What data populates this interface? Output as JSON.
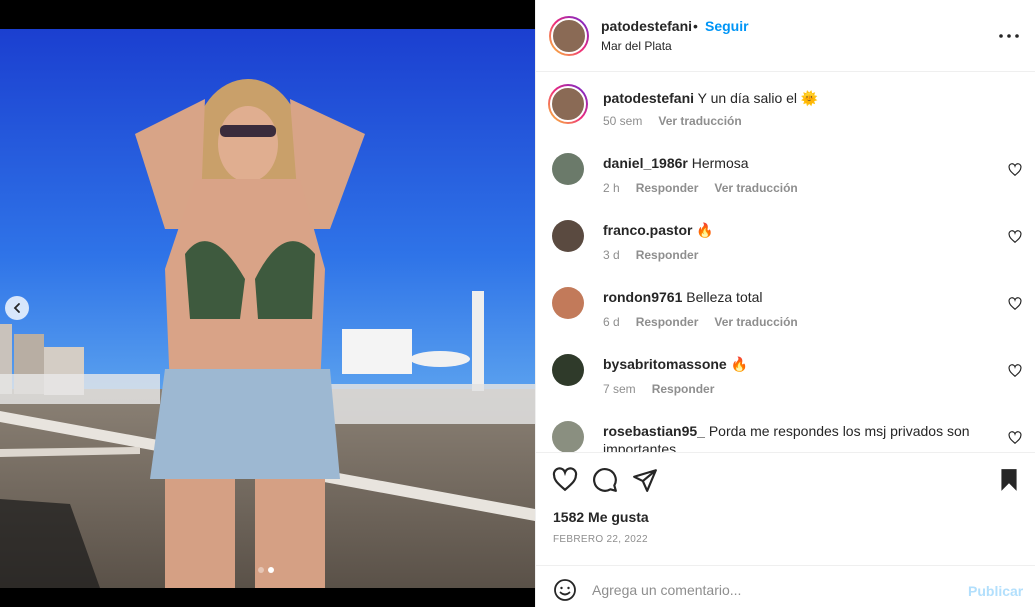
{
  "post": {
    "username": "patodestefani",
    "follow_label": "Seguir",
    "separator": "•",
    "location": "Mar del Plata"
  },
  "caption": {
    "username": "patodestefani",
    "text": "Y un día salio el 🌞",
    "time": "50 sem",
    "translate": "Ver traducción"
  },
  "comments": [
    {
      "username": "daniel_1986r",
      "text": "Hermosa",
      "time": "2 h",
      "reply": "Responder",
      "translate": "Ver traducción",
      "avatar_color": "#6b7a6a"
    },
    {
      "username": "franco.pastor",
      "text": "🔥",
      "time": "3 d",
      "reply": "Responder",
      "translate": "",
      "avatar_color": "#5a4a40"
    },
    {
      "username": "rondon9761",
      "text": "Belleza total",
      "time": "6 d",
      "reply": "Responder",
      "translate": "Ver traducción",
      "avatar_color": "#c27a5a"
    },
    {
      "username": "bysabritomassone",
      "text": "🔥",
      "time": "7 sem",
      "reply": "Responder",
      "translate": "",
      "avatar_color": "#2f3a2a"
    },
    {
      "username": "rosebastian95_",
      "text": "Porda me respondes los msj privados son importantes",
      "time": "",
      "reply": "",
      "translate": "",
      "avatar_color": "#8a8f80"
    }
  ],
  "likes": "1582 Me gusta",
  "date": "FEBRERO 22, 2022",
  "add_comment": {
    "placeholder": "Agrega un comentario...",
    "publish": "Publicar"
  },
  "carousel": {
    "count": 2,
    "active": 2
  },
  "colors": {
    "link": "#0095f6",
    "publish_disabled": "#b2dffc",
    "muted": "#8e8e8e"
  }
}
